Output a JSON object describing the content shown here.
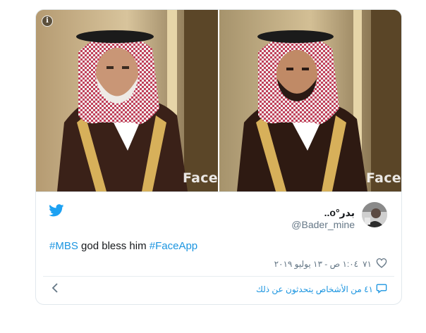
{
  "tweet": {
    "media": {
      "watermark_left": "Face",
      "watermark_right": "Face",
      "info_icon": "i"
    },
    "author": {
      "display_name": "بدر°o..",
      "handle": "@Bader_mine"
    },
    "text": {
      "hashtag1": "#MBS",
      "middle": " god bless him ",
      "hashtag2": "#FaceApp"
    },
    "meta": {
      "like_count": "٧١",
      "timestamp": "١:٠٤ ص - ١٣ يوليو ٢٠١٩"
    },
    "footer": {
      "people_talking": "٤١ من الأشخاص يتحدثون عن ذلك",
      "back_icon": "chevron-left-icon"
    },
    "colors": {
      "link": "#1b95e0",
      "muted": "#657786",
      "border": "#e1e8ed"
    }
  }
}
